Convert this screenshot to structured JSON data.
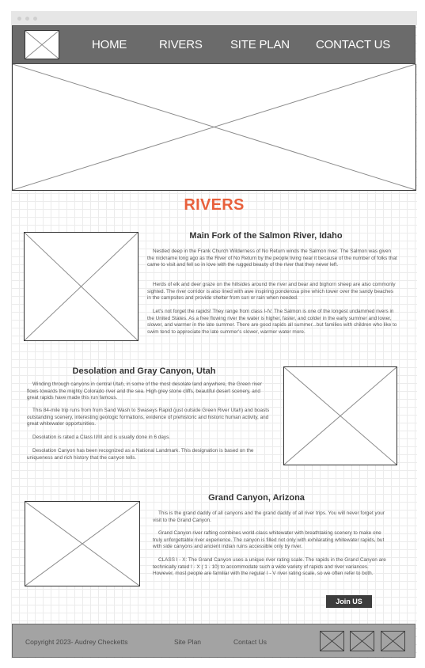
{
  "nav": {
    "links": [
      "HOME",
      "RIVERS",
      "SITE PLAN",
      "CONTACT US"
    ]
  },
  "page": {
    "title": "RIVERS"
  },
  "sections": [
    {
      "title": "Main Fork of the Salmon River, Idaho",
      "paragraphs": [
        "Nestled deep in the Frank Church Wilderness of No Return winds the Salmon river. The Salmon was given the nickname long ago as the River of No Return by the people living near it because of the number of folks that came to visit and fell so in love with the rugged beauty of the river that they never left.",
        "Herds of elk and deer graze on the hillsides around the river and bear and bighorn sheep are also commonly sighted. The river corridor is also lined with awe inspiring ponderosa pine which tower over the sandy beaches in the campsites and provide shelter from sun or rain when needed.",
        "Let's not forget the rapids! They range from class I-IV. The Salmon is one of the longest undammed rivers in the United States. As a free flowing river the water is higher, faster, and colder in the early summer and lower, slower, and warmer in the late summer. There are good rapids all summer...but families with children who like to swim tend to appreciate the late summer's slower, warmer water more."
      ]
    },
    {
      "title": "Desolation and Gray Canyon, Utah",
      "paragraphs": [
        "Winding through canyons in central Utah, in some of the most desolate land anywhere, the Green river flows towards the mighty Colorado river and the sea. High grey stone cliffs, beautiful desert scenery, and great rapids have made this run famous.",
        "This 84-mile trip runs from from Sand Wash to Swaseys Rapid (just outside Green River Utah) and boasts outstanding scenery, interesting geologic formations, evidence of prehistoric and historic human activity, and great whitewater opportunities.",
        "Desolation is rated a Class II/III and is usually done in 6 days.",
        "Desolation Canyon has been recognized as a National Landmark. This designation is based on the uniqueness and rich history that the canyon tells."
      ]
    },
    {
      "title": "Grand Canyon, Arizona",
      "paragraphs": [
        "This is the grand daddy of all canyons and the grand daddy of all river trips. You will never forget your visit to the Grand Canyon.",
        "Grand Canyon river rafting combines world-class whitewater with breathtaking scenery to make one truly unforgettable river experience. The canyon is filled not only with exhilarating whitewater rapids, but with side canyons and ancient indian ruins accessible only by river.",
        "CLASS I - X: The Grand Canyon uses a unique river rating scale. The rapids in the Grand Canyon are technically rated I - X ( 1 - 10) to accommodate such a wide variety of rapids and river variances. However, most people are familiar with the regular I - V river rating scale, so we often refer to both."
      ]
    }
  ],
  "join_button": "Join US",
  "footer": {
    "copyright": "Copyright 2023- Audrey Checketts",
    "links": [
      "Site Plan",
      "Contact Us"
    ]
  }
}
